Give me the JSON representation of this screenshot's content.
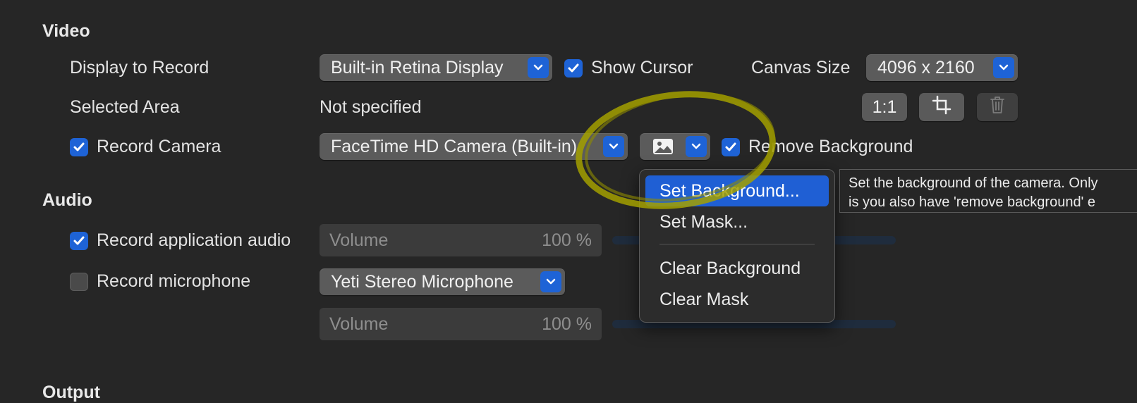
{
  "video": {
    "section_title": "Video",
    "display_to_record": {
      "label": "Display to Record",
      "value": "Built-in Retina Display"
    },
    "show_cursor": {
      "label": "Show Cursor",
      "checked": true
    },
    "canvas_size": {
      "label": "Canvas Size",
      "value": "4096 x 2160"
    },
    "selected_area": {
      "label": "Selected Area",
      "value": "Not specified"
    },
    "area_buttons": {
      "aspect_label": "1:1",
      "crop_icon": "crop-icon",
      "trash_icon": "trash-icon"
    },
    "record_camera": {
      "label": "Record Camera",
      "checked": true,
      "value": "FaceTime HD Camera (Built-in)"
    },
    "background_popup_icon": "image-icon",
    "remove_background": {
      "label": "Remove Background",
      "checked": true
    }
  },
  "audio": {
    "section_title": "Audio",
    "record_app_audio": {
      "label": "Record application audio",
      "checked": true
    },
    "app_volume": {
      "placeholder": "Volume",
      "value": "100 %"
    },
    "record_microphone": {
      "label": "Record microphone",
      "checked": false,
      "value": "Yeti Stereo Microphone"
    },
    "mic_volume": {
      "placeholder": "Volume",
      "value": "100 %"
    }
  },
  "output": {
    "section_title": "Output"
  },
  "background_menu": {
    "items": [
      {
        "label": "Set Background...",
        "selected": true
      },
      {
        "label": "Set Mask...",
        "selected": false
      },
      {
        "label": "Clear Background",
        "selected": false
      },
      {
        "label": "Clear Mask",
        "selected": false
      }
    ]
  },
  "tooltip": {
    "line1": "Set the background of the camera. Only",
    "line2": "is you also have 'remove background' e"
  },
  "colors": {
    "accent": "#1e63d6",
    "highlight_annotation": "#a3a000",
    "background": "#262626"
  }
}
